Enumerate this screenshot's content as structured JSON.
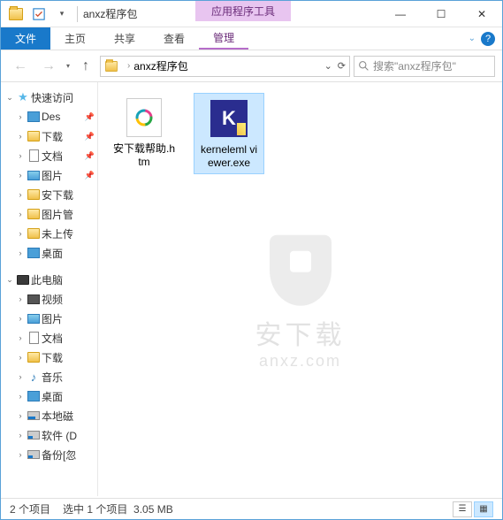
{
  "title": "anxz程序包",
  "context_tab_title": "应用程序工具",
  "ribbon": {
    "file": "文件",
    "home": "主页",
    "share": "共享",
    "view": "查看",
    "manage": "管理"
  },
  "breadcrumb": {
    "current": "anxz程序包"
  },
  "search_placeholder": "搜索\"anxz程序包\"",
  "sidebar": {
    "quick": "快速访问",
    "items": [
      {
        "label": "Des",
        "icon": "blue",
        "pin": true
      },
      {
        "label": "下载",
        "icon": "folder",
        "pin": true
      },
      {
        "label": "文档",
        "icon": "doc",
        "pin": true
      },
      {
        "label": "图片",
        "icon": "pic",
        "pin": true
      },
      {
        "label": "安下载",
        "icon": "folder",
        "pin": false
      },
      {
        "label": "图片管",
        "icon": "folder",
        "pin": false
      },
      {
        "label": "未上传",
        "icon": "folder",
        "pin": false
      },
      {
        "label": "桌面",
        "icon": "blue",
        "pin": false
      }
    ],
    "thispc": "此电脑",
    "pc_items": [
      {
        "label": "视频",
        "icon": "video"
      },
      {
        "label": "图片",
        "icon": "pic"
      },
      {
        "label": "文档",
        "icon": "doc"
      },
      {
        "label": "下载",
        "icon": "folder"
      },
      {
        "label": "音乐",
        "icon": "music"
      },
      {
        "label": "桌面",
        "icon": "blue"
      },
      {
        "label": "本地磁",
        "icon": "diskc"
      },
      {
        "label": "软件 (D",
        "icon": "diskd"
      },
      {
        "label": "备份[忽",
        "icon": "diskd"
      }
    ]
  },
  "files": [
    {
      "name": "安下载帮助.htm",
      "type": "htm",
      "selected": false
    },
    {
      "name": "kerneleml viewer.exe",
      "type": "exe",
      "selected": true
    }
  ],
  "status": {
    "count": "2 个项目",
    "selected": "选中 1 个项目",
    "size": "3.05 MB"
  },
  "watermark": {
    "text": "安下载",
    "url": "anxz.com"
  }
}
